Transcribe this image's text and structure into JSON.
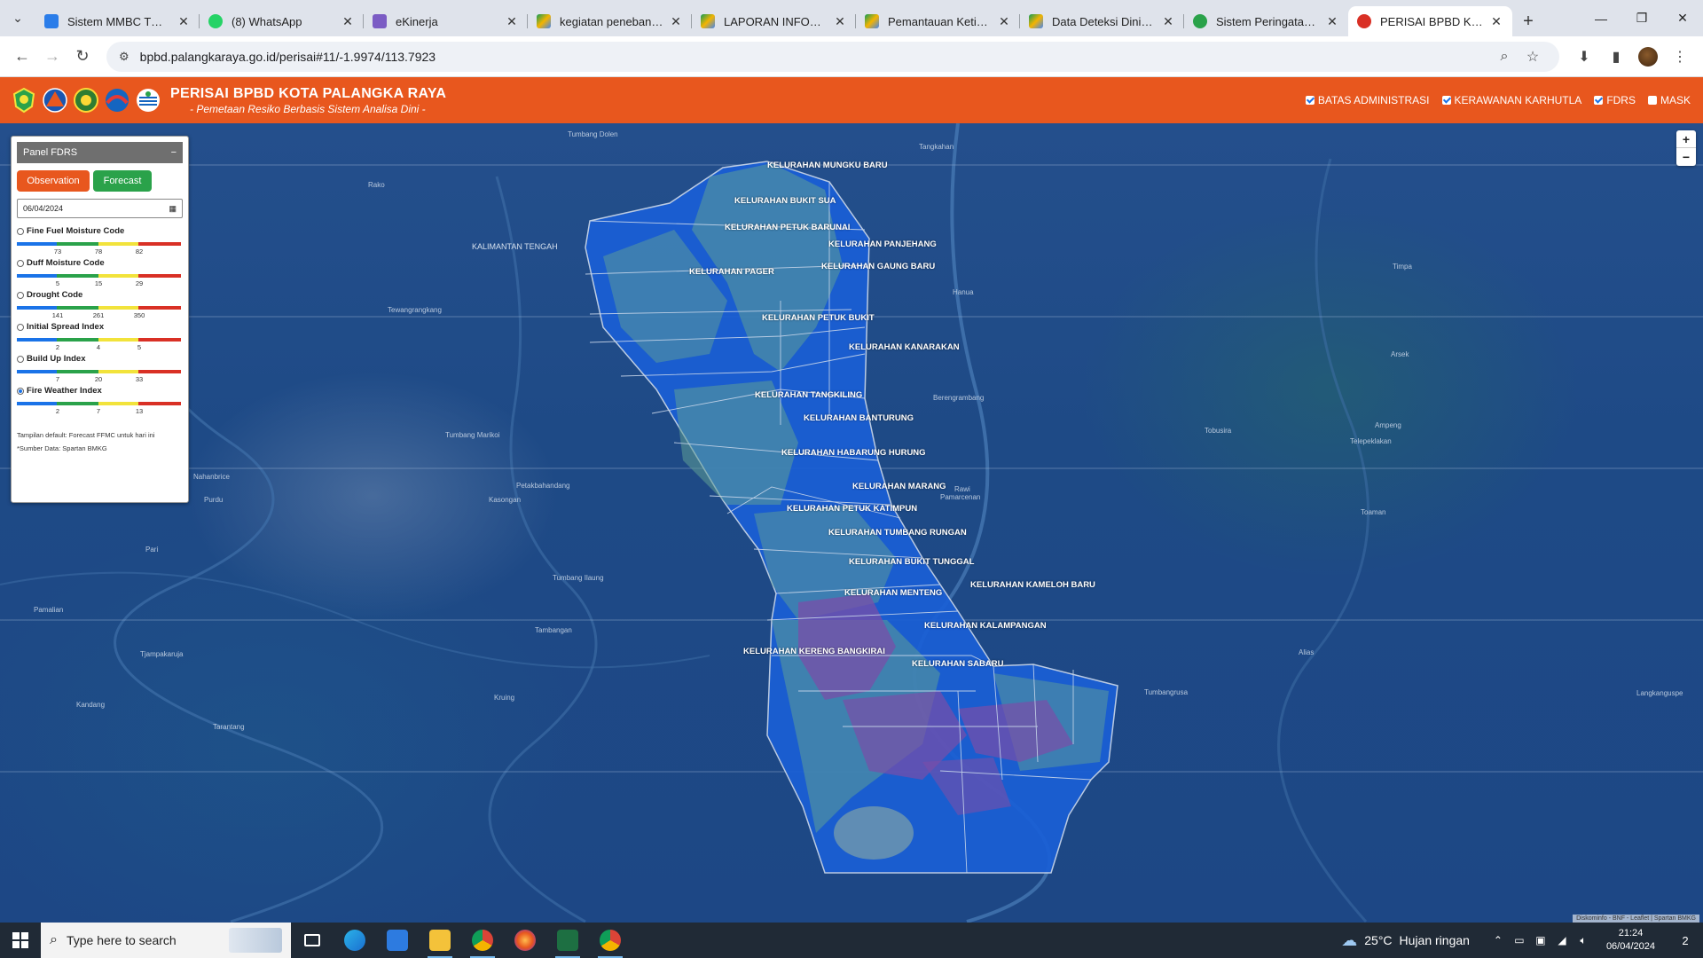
{
  "browser": {
    "tabs": [
      {
        "title": "Sistem MMBC TOUR",
        "color": "#2b7de9"
      },
      {
        "title": "(8) WhatsApp",
        "color": "#25d366"
      },
      {
        "title": "eKinerja",
        "color": "#7b5cc4"
      },
      {
        "title": "kegiatan penebangan",
        "color": "#f4b400"
      },
      {
        "title": "LAPORAN INFORMASI",
        "color": "#f4b400"
      },
      {
        "title": "Pemantauan Ketinggian",
        "color": "#f4b400"
      },
      {
        "title": "Data Deteksi Dini Karhutla",
        "color": "#f4b400"
      },
      {
        "title": "Sistem Peringatan Ke",
        "color": "#2aa24a"
      },
      {
        "title": "PERISAI BPBD Kota P",
        "color": "#d93025"
      }
    ],
    "url": "bpbd.palangkaraya.go.id/perisai#11/-1.9974/113.7923"
  },
  "app": {
    "title": "PERISAI BPBD KOTA PALANGKA RAYA",
    "subtitle": "- Pemetaan Resiko Berbasis Sistem Analisa Dini -",
    "layers": [
      {
        "label": "BATAS ADMINISTRASI",
        "checked": true
      },
      {
        "label": "KERAWANAN KARHUTLA",
        "checked": true
      },
      {
        "label": "FDRS",
        "checked": true
      },
      {
        "label": "MASK",
        "checked": false
      }
    ]
  },
  "panel": {
    "title": "Panel FDRS",
    "collapse": "−",
    "observation_label": "Observation",
    "forecast_label": "Forecast",
    "date": "06/04/2024",
    "indices": [
      {
        "label": "Fine Fuel Moisture Code",
        "ticks": [
          "73",
          "78",
          "82"
        ],
        "selected": false
      },
      {
        "label": "Duff Moisture Code",
        "ticks": [
          "5",
          "15",
          "29"
        ],
        "selected": false
      },
      {
        "label": "Drought Code",
        "ticks": [
          "141",
          "261",
          "350"
        ],
        "selected": false
      },
      {
        "label": "Initial Spread Index",
        "ticks": [
          "2",
          "4",
          "5"
        ],
        "selected": false
      },
      {
        "label": "Build Up Index",
        "ticks": [
          "7",
          "20",
          "33"
        ],
        "selected": false
      },
      {
        "label": "Fire Weather Index",
        "ticks": [
          "2",
          "7",
          "13"
        ],
        "selected": true
      }
    ],
    "scale_colors": [
      "#1a73e8",
      "#2aa24a",
      "#f2e33b",
      "#d93025"
    ],
    "note": "Tampilan default: Forecast FFMC untuk hari ini",
    "source": "*Sumber Data: Spartan BMKG"
  },
  "map": {
    "kelurahan": [
      "KELURAHAN MUNGKU BARU",
      "KELURAHAN BUKIT SUA",
      "KELURAHAN PETUK BARUNAI",
      "KELURAHAN PANJEHANG",
      "KELURAHAN PAGER",
      "KELURAHAN GAUNG BARU",
      "KELURAHAN PETUK BUKIT",
      "KELURAHAN KANARAKAN",
      "KELURAHAN TANGKILING",
      "KELURAHAN BANTURUNG",
      "KELURAHAN HABARUNG HURUNG",
      "KELURAHAN MARANG",
      "KELURAHAN PETUK KATIMPUN",
      "KELURAHAN TUMBANG RUNGAN",
      "KELURAHAN BUKIT TUNGGAL",
      "KELURAHAN KAMELOH BARU",
      "KELURAHAN MENTENG",
      "KELURAHAN KALAMPANGAN",
      "KELURAHAN KERENG BANGKIRAI",
      "KELURAHAN SABARU"
    ],
    "places": [
      "Tumbang Dolen",
      "Tangkahan",
      "Rako",
      "KALIMANTAN TENGAH",
      "Tewangrangkang",
      "Hanua",
      "Timpa",
      "Arsek",
      "Berengrambang",
      "Tumbang Marikoi",
      "Ampeng",
      "Purdu",
      "Kasongan",
      "Pamarcenan",
      "Tobusira",
      "Telepeklakan",
      "Nahanbrice",
      "Petakbahandang",
      "Rawi",
      "Toaman",
      "Pari",
      "Tumbang Ilaung",
      "Pamalian",
      "Tambangan",
      "Tjampakaruja",
      "Alias",
      "Kandang",
      "Kruing",
      "Tumbangrusa",
      "Tarantang",
      "Langkanguspe"
    ],
    "attribution": "Diskominfo - BNF - Leaflet | Spartan BMKG",
    "zoom_in": "+",
    "zoom_out": "−"
  },
  "taskbar": {
    "search_placeholder": "Type here to search",
    "weather_temp": "25°C",
    "weather_desc": "Hujan ringan",
    "time": "21:24",
    "date": "06/04/2024",
    "notifications": "2"
  }
}
